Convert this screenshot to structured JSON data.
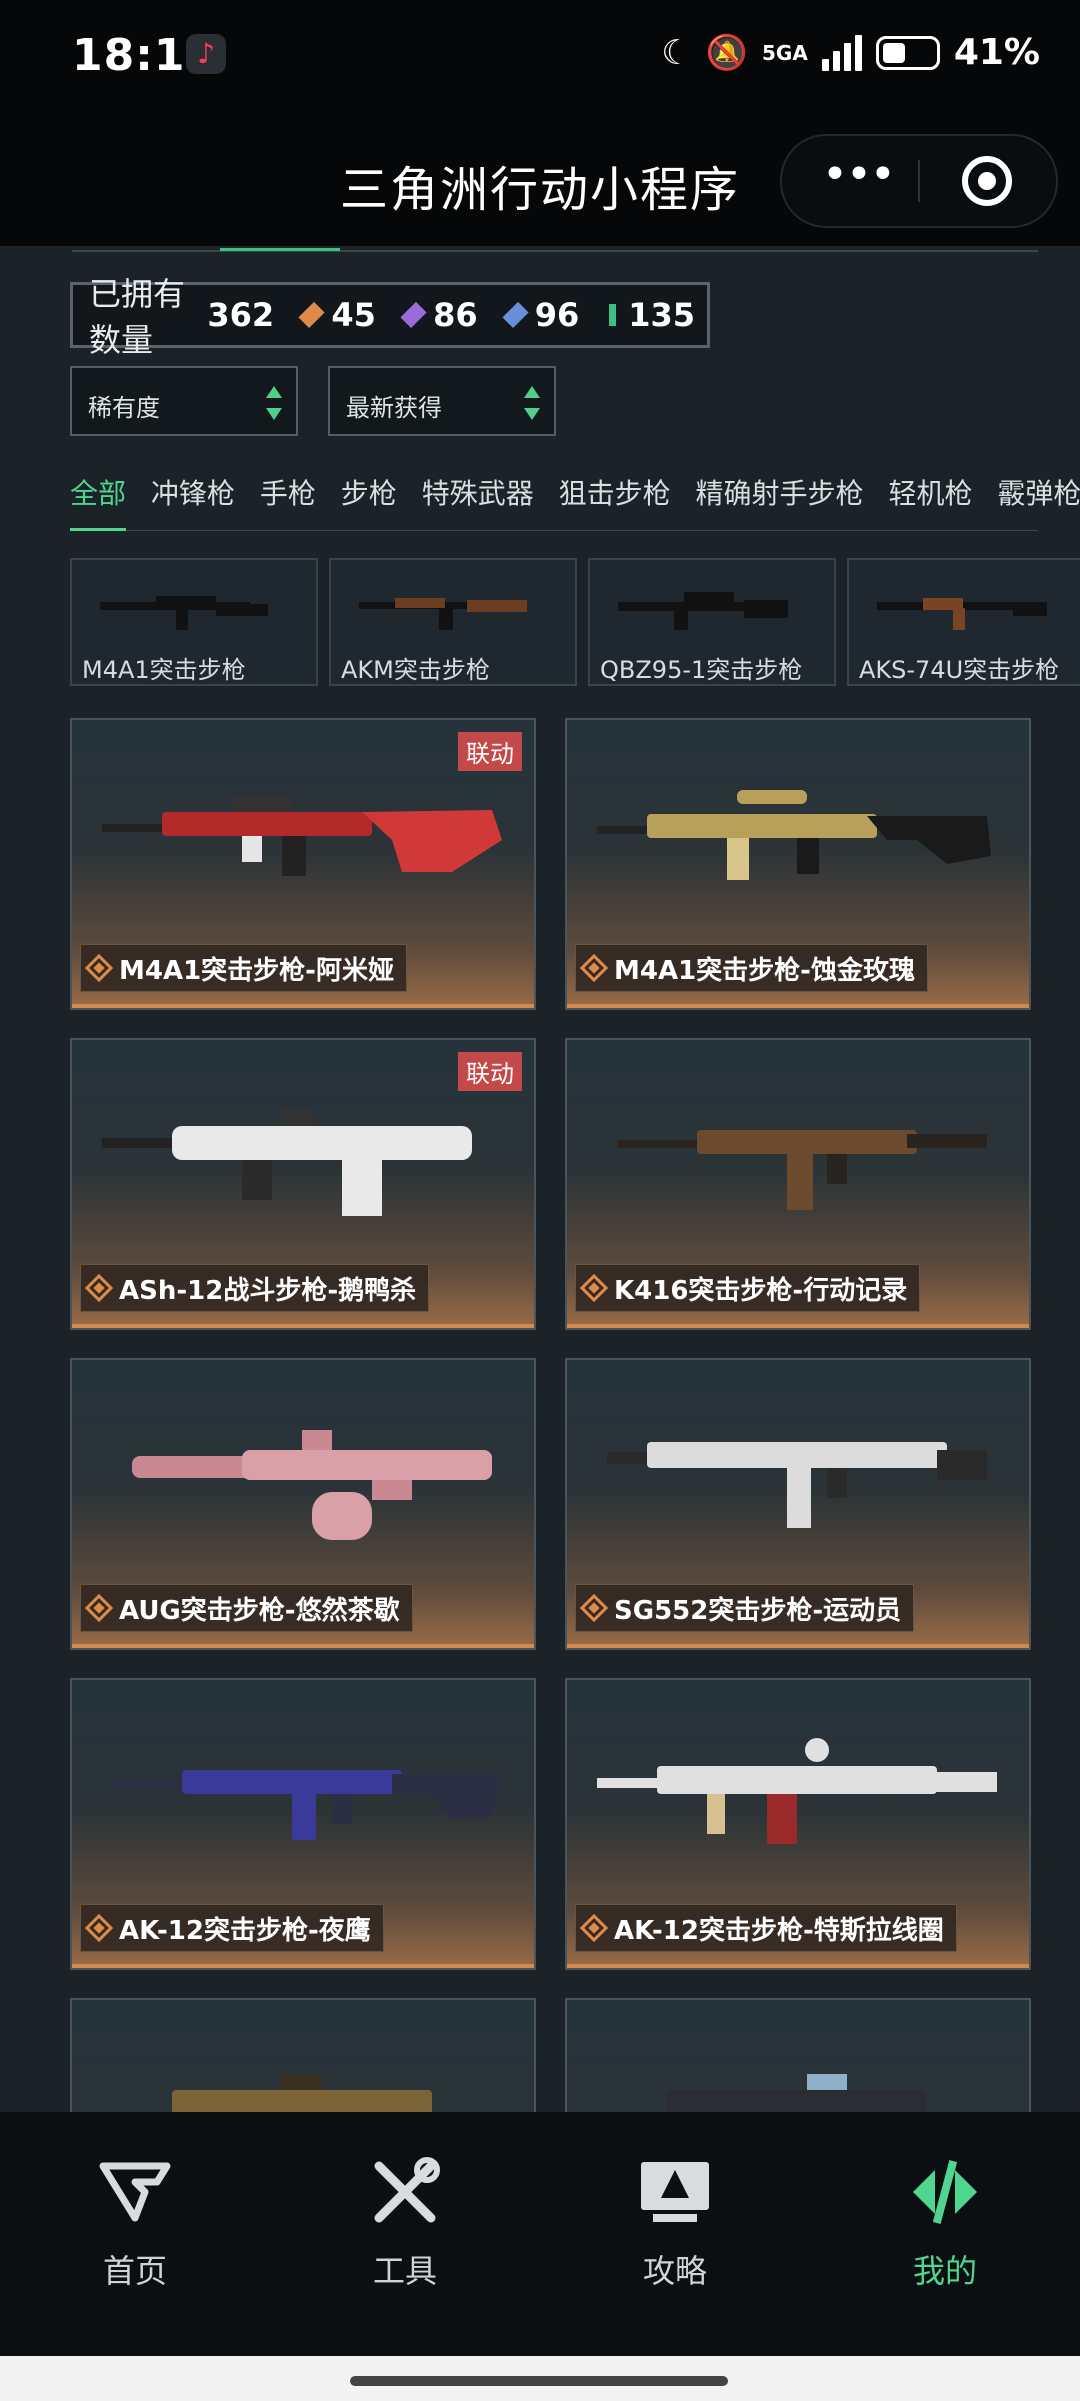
{
  "status_bar": {
    "time": "18:17",
    "network": "5GA",
    "battery": "41%"
  },
  "header": {
    "title": "三角洲行动小程序",
    "more_label": "•••"
  },
  "stats": {
    "owned_label": "已拥有数量",
    "owned_total": "362",
    "counts": [
      {
        "value": "45",
        "color": "#e08a4a"
      },
      {
        "value": "86",
        "color": "#9b6bd9"
      },
      {
        "value": "96",
        "color": "#6a8fd9"
      },
      {
        "value": "135",
        "color": "#3fbf84"
      }
    ]
  },
  "filters": {
    "rarity": "稀有度",
    "sort": "最新获得"
  },
  "tabs": [
    "全部",
    "冲锋枪",
    "手枪",
    "步枪",
    "特殊武器",
    "狙击步枪",
    "精确射手步枪",
    "轻机枪",
    "霰弹枪"
  ],
  "weapon_strip": [
    "M4A1突击步枪",
    "AKM突击步枪",
    "QBZ95-1突击步枪",
    "AKS-74U突击步枪"
  ],
  "skins": [
    {
      "name": "M4A1突击步枪-阿米娅",
      "badge": "联动",
      "accent": "#b22a2a",
      "stock": "#d13838"
    },
    {
      "name": "M4A1突击步枪-蚀金玫瑰",
      "badge": "",
      "accent": "#1a1a1a",
      "stock": "#b9a05a"
    },
    {
      "name": "ASh-12战斗步枪-鹅鸭杀",
      "badge": "联动",
      "accent": "#e9e9e9",
      "stock": "#2a2a2a"
    },
    {
      "name": "K416突击步枪-行动记录",
      "badge": "",
      "accent": "#6b4a2e",
      "stock": "#2a2420"
    },
    {
      "name": "AUG突击步枪-悠然茶歇",
      "badge": "",
      "accent": "#d9a0a8",
      "stock": "#c98892"
    },
    {
      "name": "SG552突击步枪-运动员",
      "badge": "",
      "accent": "#dcdcdc",
      "stock": "#2a2a2a"
    },
    {
      "name": "AK-12突击步枪-夜鹰",
      "badge": "",
      "accent": "#3a3a9a",
      "stock": "#2c2e44"
    },
    {
      "name": "AK-12突击步枪-特斯拉线圈",
      "badge": "",
      "accent": "#e0e0e0",
      "stock": "#9a2a2a"
    }
  ],
  "bottom_nav": [
    {
      "label": "首页",
      "icon": "logo-icon"
    },
    {
      "label": "工具",
      "icon": "tools-icon"
    },
    {
      "label": "攻略",
      "icon": "guide-icon"
    },
    {
      "label": "我的",
      "icon": "profile-icon",
      "active": true
    }
  ]
}
